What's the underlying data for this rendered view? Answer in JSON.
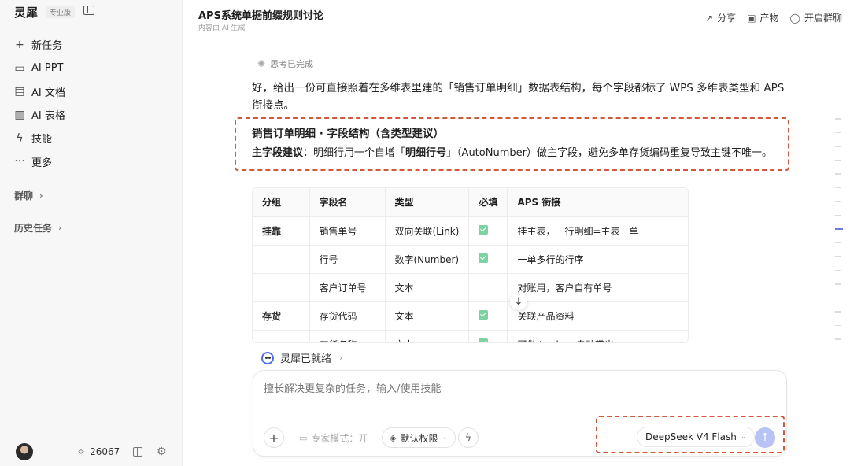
{
  "sidebar": {
    "brand": "灵犀",
    "badge": "专业版",
    "items": [
      {
        "icon": "plus-icon",
        "glyph": "+",
        "label": "新任务"
      },
      {
        "icon": "slides-icon",
        "glyph": "▭",
        "label": "AI PPT"
      },
      {
        "icon": "document-icon",
        "glyph": "▤",
        "label": "AI 文档"
      },
      {
        "icon": "chart-icon",
        "glyph": "▥",
        "label": "AI 表格"
      },
      {
        "icon": "bolt-icon",
        "glyph": "ϟ",
        "label": "技能"
      },
      {
        "icon": "more-icon",
        "glyph": "···",
        "label": "更多"
      }
    ],
    "sections": [
      {
        "label": "群聊",
        "chevron": "›"
      },
      {
        "label": "历史任务",
        "chevron": "›"
      }
    ],
    "credits": "26067"
  },
  "header": {
    "title": "APS系统单据前缀规则讨论",
    "subtitle": "内容由 AI 生成",
    "actions": [
      {
        "icon": "share-icon",
        "glyph": "↗",
        "label": "分享"
      },
      {
        "icon": "artifact-icon",
        "glyph": "▣",
        "label": "产物"
      },
      {
        "icon": "group-chat-icon",
        "glyph": "◯",
        "label": "开启群聊"
      }
    ]
  },
  "message": {
    "thinking": "思考已完成",
    "intro": "好，给出一份可直接照着在多维表里建的「销售订单明细」数据表结构，每个字段都标了 WPS 多维表类型和 APS 衔接点。",
    "section_title": "销售订单明细 · 字段结构（含类型建议）",
    "pk_label": "主字段建议",
    "pk_text_1": "：明细行用一个自增「",
    "pk_bold": "明细行号",
    "pk_text_2": "」（AutoNumber）做主字段，避免多单存货编码重复导致主键不唯一。"
  },
  "table": {
    "headers": [
      "分组",
      "字段名",
      "类型",
      "必填",
      "APS 衔接"
    ],
    "rows": [
      {
        "group": "挂靠",
        "field": "销售单号",
        "type": "双向关联(Link)",
        "required": true,
        "aps": "挂主表，一行明细=主表一单"
      },
      {
        "group": "",
        "field": "行号",
        "type": "数字(Number)",
        "required": true,
        "aps": "一单多行的行序"
      },
      {
        "group": "",
        "field": "客户订单号",
        "type": "文本",
        "required": false,
        "aps": "对账用，客户自有单号"
      },
      {
        "group": "存货",
        "field": "存货代码",
        "type": "文本",
        "required": true,
        "aps": "关联产品资料"
      },
      {
        "group": "",
        "field": "存货名称",
        "type": "文本",
        "required": true,
        "aps": "可做 Lookup 自动带出"
      }
    ]
  },
  "status": {
    "ready": "灵犀已就绪",
    "chevron": "›"
  },
  "composer": {
    "placeholder": "擅长解决更复杂的任务，输入/使用技能",
    "expert_mode": "专家模式：开",
    "permission": "默认权限",
    "model": "DeepSeek V4 Flash",
    "send_glyph": "↑"
  },
  "colors": {
    "callout_border": "#d2583b",
    "send_button": "#b7c3f5",
    "check": "#7ed1a0"
  }
}
